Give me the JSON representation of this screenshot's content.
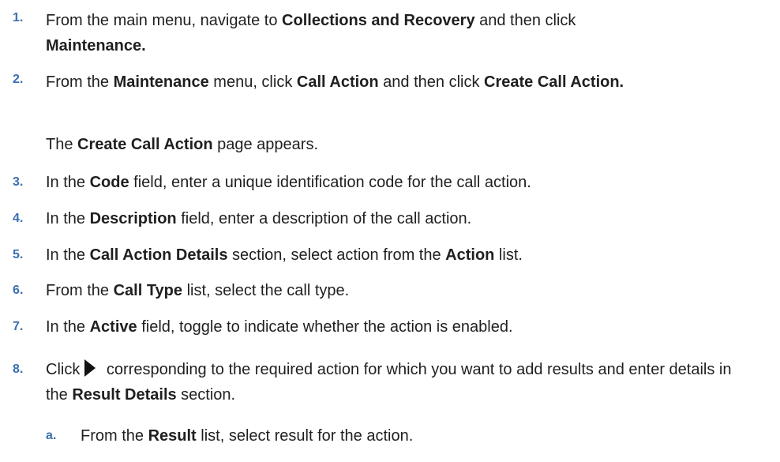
{
  "steps": [
    {
      "num": "1.",
      "parts": [
        "From the main menu, navigate to ",
        "Collections and Recovery",
        " and then click ",
        "Maintenance."
      ]
    },
    {
      "num": "2.",
      "parts": [
        "From the ",
        "Maintenance",
        " menu, click ",
        "Call Action",
        " and then click ",
        "Create Call Action."
      ],
      "note": [
        "The ",
        "Create Call Action",
        " page appears."
      ]
    },
    {
      "num": "3.",
      "parts": [
        "In the ",
        "Code",
        " field, enter a unique identification code for the call action."
      ]
    },
    {
      "num": "4.",
      "parts": [
        "In the ",
        "Description",
        " field, enter a description of the call action."
      ]
    },
    {
      "num": "5.",
      "parts": [
        "In the ",
        "Call Action Details",
        " section, select action from the ",
        "Action",
        " list."
      ]
    },
    {
      "num": "6.",
      "parts": [
        "From the ",
        "Call Type",
        " list, select the call type."
      ]
    },
    {
      "num": "7.",
      "parts": [
        "In the ",
        "Active",
        " field, toggle to indicate whether the action is enabled."
      ]
    },
    {
      "num": "8.",
      "parts": [
        "Click",
        " corresponding to the required action for which you want to add results and enter details in the ",
        "Result Details",
        " section."
      ],
      "icon": "expand-arrow-icon"
    }
  ],
  "substeps": [
    {
      "num": "a.",
      "parts": [
        "From the ",
        "Result",
        " list, select result for the action."
      ]
    }
  ]
}
